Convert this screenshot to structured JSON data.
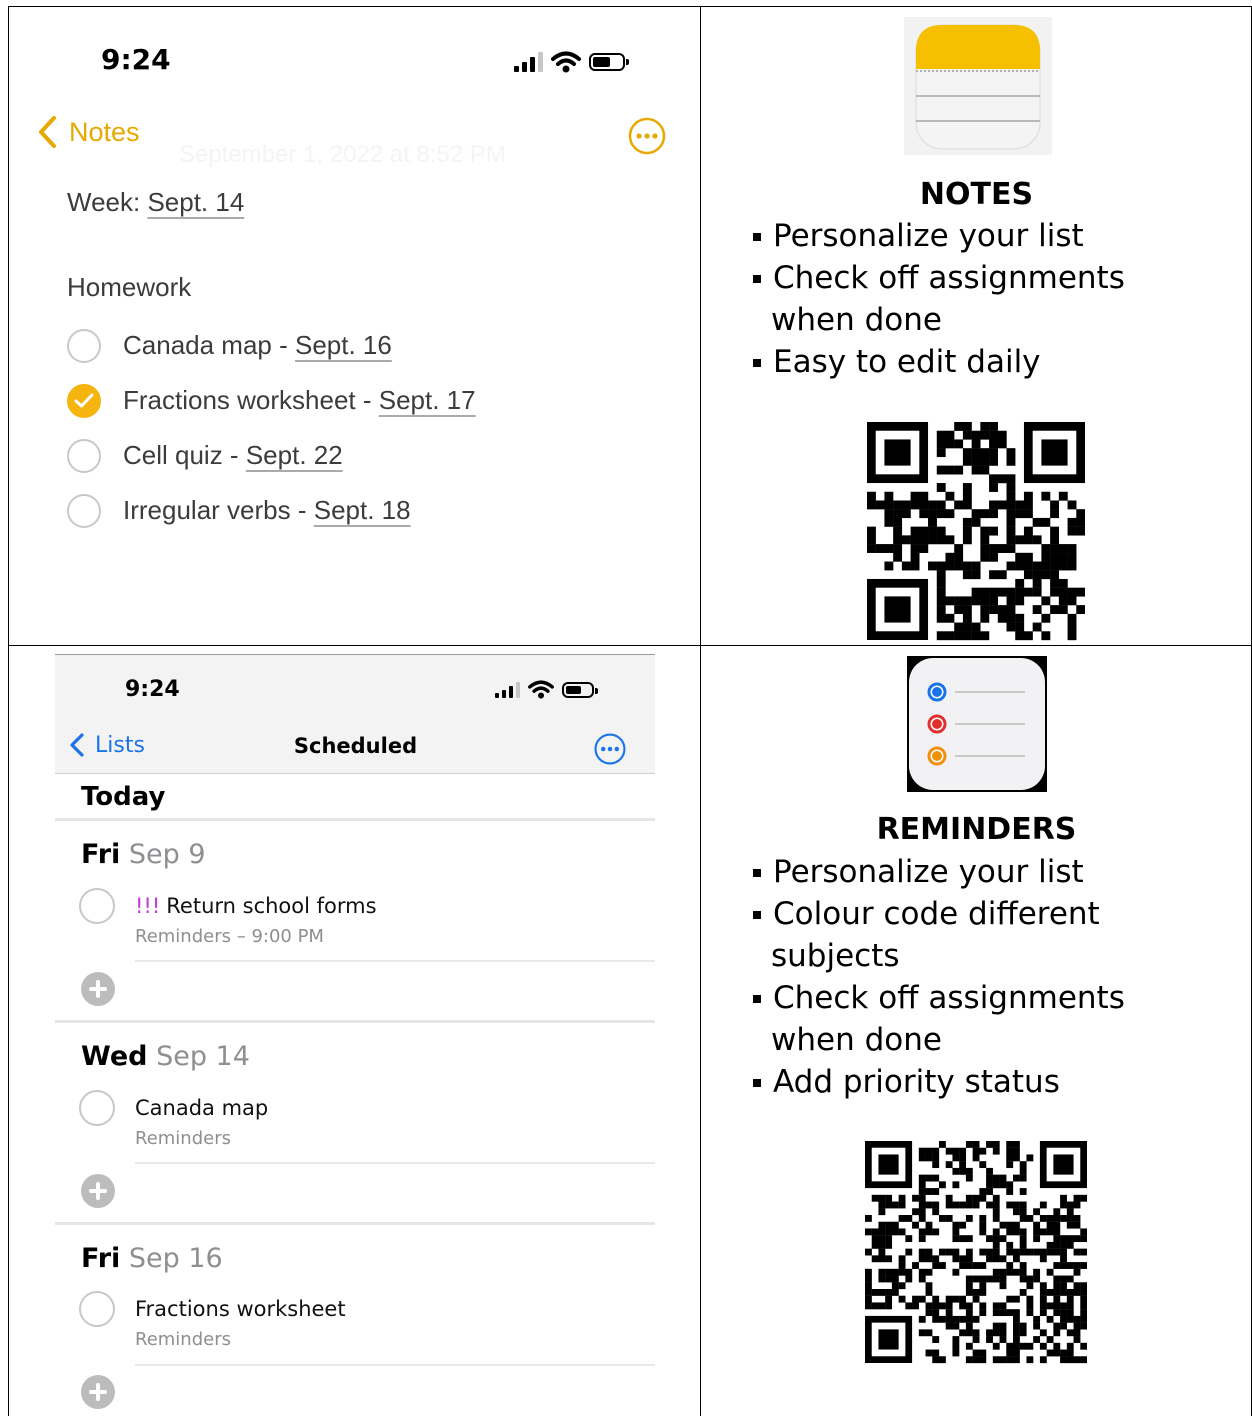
{
  "notes_screen": {
    "time": "9:24",
    "back_label": "Notes",
    "faded_date": "September 1, 2022 at 8:52 PM",
    "week_prefix": "Week: ",
    "week_date": "Sept. 14",
    "section": "Homework",
    "items": [
      {
        "text": "Canada map - ",
        "date": "Sept. 16",
        "checked": false
      },
      {
        "text": "Fractions worksheet - ",
        "date": "Sept. 17",
        "checked": true
      },
      {
        "text": "Cell quiz - ",
        "date": "Sept. 22",
        "checked": false
      },
      {
        "text": "Irregular verbs - ",
        "date": "Sept. 18",
        "checked": false
      }
    ],
    "accent": "#f6b40e"
  },
  "notes_info": {
    "icon": "notes-app-icon",
    "title": "NOTES",
    "bullets": [
      "Personalize your list",
      "Check off assignments",
      "when done",
      "Easy to edit daily"
    ]
  },
  "reminders_screen": {
    "time": "9:24",
    "back_label": "Lists",
    "heading": "Scheduled",
    "today": "Today",
    "days": [
      {
        "weekday": "Fri",
        "date": "Sep 9",
        "priority": "!!!",
        "task": "Return school forms",
        "sub": "Reminders – 9:00 PM"
      },
      {
        "weekday": "Wed",
        "date": "Sep 14",
        "priority": "",
        "task": "Canada map",
        "sub": "Reminders"
      },
      {
        "weekday": "Fri",
        "date": "Sep 16",
        "priority": "",
        "task": "Fractions worksheet",
        "sub": "Reminders"
      }
    ],
    "accent": "#1a74e8"
  },
  "reminders_info": {
    "icon": "reminders-app-icon",
    "title": "REMINDERS",
    "bullets": [
      "Personalize your list",
      "Colour code different",
      "subjects",
      "Check off assignments",
      "when done",
      "Add priority status"
    ]
  }
}
